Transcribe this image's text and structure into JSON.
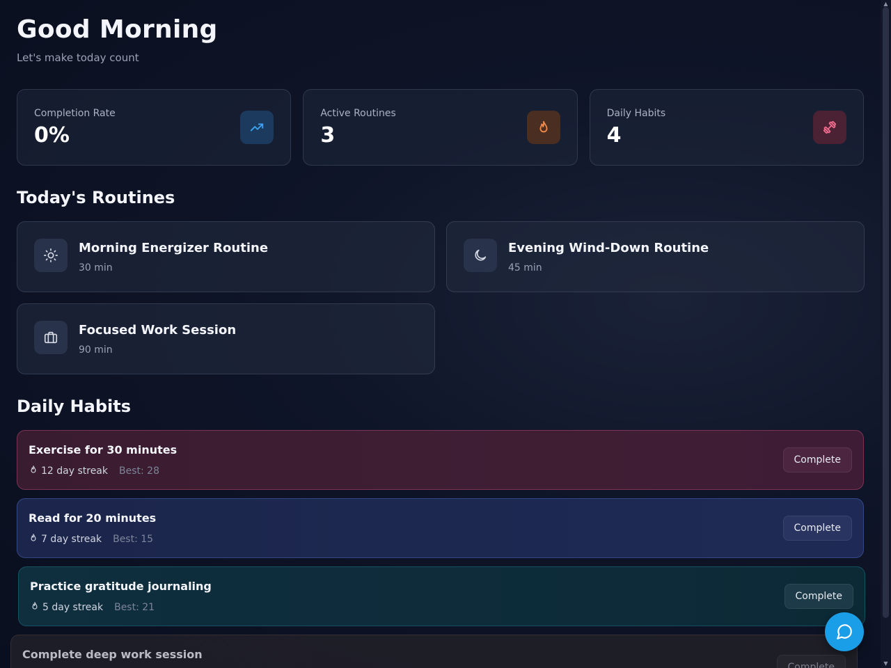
{
  "header": {
    "greeting": "Good Morning",
    "subtitle": "Let's make today count"
  },
  "stats": [
    {
      "label": "Completion Rate",
      "value": "0%",
      "icon": "trending-up-icon",
      "color": "#3ba3f0"
    },
    {
      "label": "Active Routines",
      "value": "3",
      "icon": "flame-icon",
      "color": "#f08a4b"
    },
    {
      "label": "Daily Habits",
      "value": "4",
      "icon": "dumbbell-icon",
      "color": "#f06a8c"
    }
  ],
  "routines_section": {
    "title": "Today's Routines",
    "items": [
      {
        "name": "Morning Energizer Routine",
        "duration": "30 min",
        "icon": "sun-icon"
      },
      {
        "name": "Evening Wind-Down Routine",
        "duration": "45 min",
        "icon": "moon-icon"
      },
      {
        "name": "Focused Work Session",
        "duration": "90 min",
        "icon": "briefcase-icon"
      }
    ]
  },
  "habits_section": {
    "title": "Daily Habits",
    "items": [
      {
        "name": "Exercise for 30 minutes",
        "streak": "12 day streak",
        "best": "Best: 28",
        "button": "Complete"
      },
      {
        "name": "Read for 20 minutes",
        "streak": "7 day streak",
        "best": "Best: 15",
        "button": "Complete"
      },
      {
        "name": "Practice gratitude journaling",
        "streak": "5 day streak",
        "best": "Best: 21",
        "button": "Complete"
      },
      {
        "name": "Complete deep work session",
        "streak": "",
        "best": "",
        "button": "Complete"
      }
    ]
  },
  "colors": {
    "accent": "#1a9ee8",
    "background": "#0a0f1f"
  }
}
